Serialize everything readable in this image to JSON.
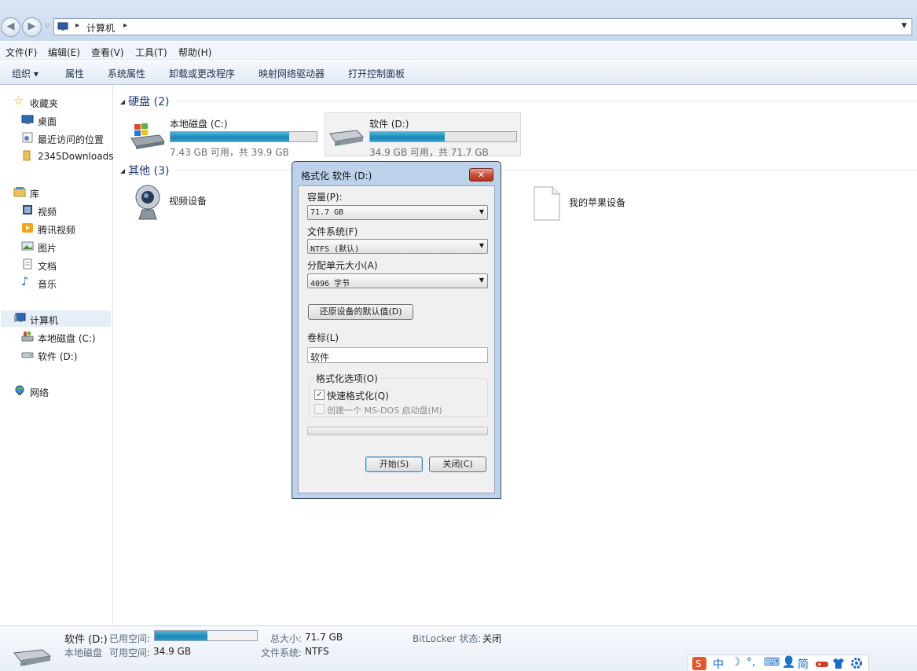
{
  "address": {
    "crumb": "计算机"
  },
  "menu": [
    "文件(F)",
    "编辑(E)",
    "查看(V)",
    "工具(T)",
    "帮助(H)"
  ],
  "commands": [
    "组织 ▾",
    "属性",
    "系统属性",
    "卸载或更改程序",
    "映射网络驱动器",
    "打开控制面板"
  ],
  "nav": {
    "favorites": "收藏夹",
    "desktop": "桌面",
    "recent": "最近访问的位置",
    "downloads": "2345Downloads",
    "libraries": "库",
    "videos": "视频",
    "tencent_video": "腾讯视频",
    "pictures": "图片",
    "documents": "文档",
    "music": "音乐",
    "computer": "计算机",
    "drive_c": "本地磁盘 (C:)",
    "drive_d": "软件 (D:)",
    "network": "网络"
  },
  "groups": {
    "hard_drives": "硬盘 (2)",
    "other": "其他 (3)"
  },
  "drives": [
    {
      "name": "本地磁盘 (C:)",
      "free": "7.43 GB 可用，共 39.9 GB",
      "used_fraction": 0.814
    },
    {
      "name": "软件 (D:)",
      "free": "34.9 GB 可用，共 71.7 GB",
      "used_fraction": 0.513
    }
  ],
  "other_items": {
    "camera": "视频设备",
    "apple": "我的苹果设备"
  },
  "details": {
    "name": "软件 (D:)",
    "type": "本地磁盘",
    "used_label": "已用空间:",
    "free_label": "可用空间:",
    "free_value": "34.9 GB",
    "total_label": "总大小:",
    "total_value": "71.7 GB",
    "fs_label": "文件系统:",
    "fs_value": "NTFS",
    "bitlocker_label": "BitLocker 状态:",
    "bitlocker_value": "关闭",
    "used_fraction": 0.513
  },
  "dialog": {
    "title": "格式化 软件 (D:)",
    "close_glyph": "✕",
    "capacity_label": "容量(P):",
    "capacity_value": "71.7 GB",
    "fs_label": "文件系统(F)",
    "fs_value": "NTFS (默认)",
    "alloc_label": "分配单元大小(A)",
    "alloc_value": "4096 字节",
    "restore_button": "还原设备的默认值(D)",
    "volume_label": "卷标(L)",
    "volume_value": "软件",
    "options_legend": "格式化选项(O)",
    "quick_format": "快速格式化(Q)",
    "msdos_disk": "创建一个 MS-DOS 启动盘(M)",
    "start_button": "开始(S)",
    "close_button": "关闭(C)",
    "progress": 0
  },
  "ime": [
    "中",
    "☽",
    "°,",
    "⌨",
    "👤",
    "简"
  ],
  "colors": {
    "drive_bar": "#1e88b6",
    "ime_logo": "#e8562a",
    "ime_icons": "#1b6cc8"
  }
}
